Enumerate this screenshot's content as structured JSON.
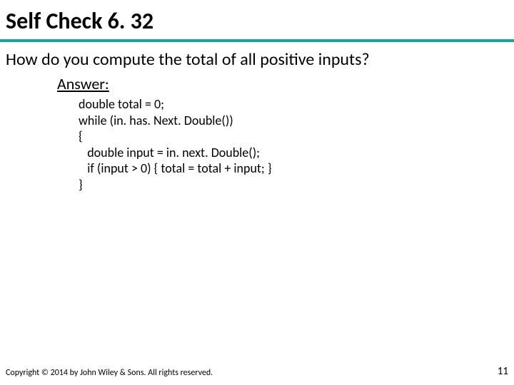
{
  "title": "Self Check 6. 32",
  "question": "How do you compute the total of all positive inputs?",
  "answer_label": "Answer:",
  "code": "double total = 0;\nwhile (in. has. Next. Double())\n{\n   double input = in. next. Double();\n   if (input > 0) { total = total + input; }\n}",
  "copyright": "Copyright © 2014 by John Wiley & Sons. All rights reserved.",
  "page_number": "11"
}
